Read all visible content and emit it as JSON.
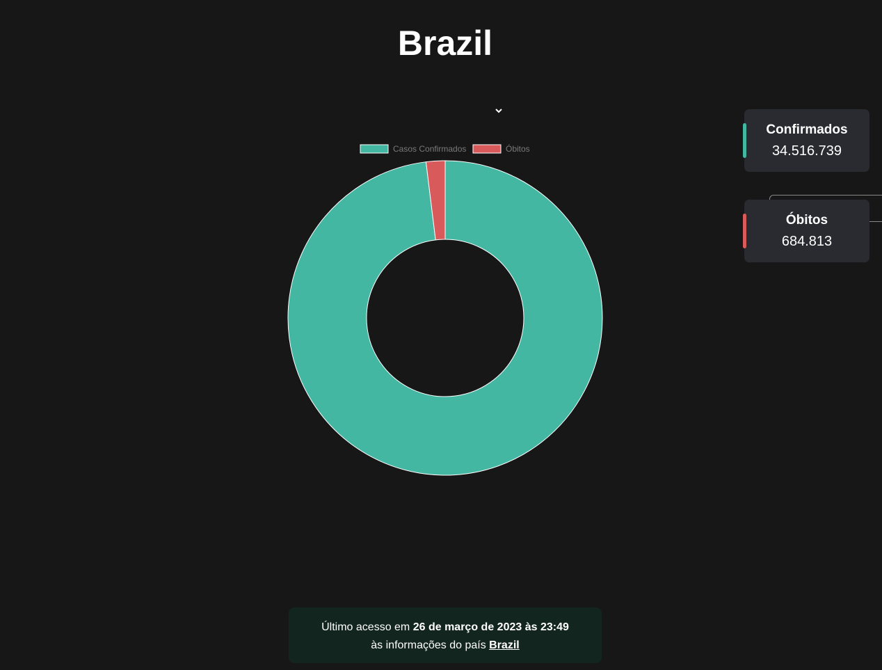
{
  "page": {
    "title": "Brazil"
  },
  "selector": {
    "selected": "Brazil"
  },
  "stats": {
    "confirmed": {
      "label": "Confirmados",
      "value": "34.516.739",
      "color": "#43b7a2"
    },
    "deaths": {
      "label": "Óbitos",
      "value": "684.813",
      "color": "#d85a5a"
    }
  },
  "footer": {
    "prefix": "Último acesso em",
    "datetime": "26 de março de 2023 às 23:49",
    "line2_prefix": "às informações do país",
    "country_link": "Brazil"
  },
  "chart_data": {
    "type": "pie",
    "variant": "doughnut",
    "categories": [
      "Casos Confirmados",
      "Óbitos"
    ],
    "values": [
      34516739,
      684813
    ],
    "colors": [
      "#43b7a2",
      "#d85a5a"
    ],
    "legend": "top",
    "title": ""
  }
}
